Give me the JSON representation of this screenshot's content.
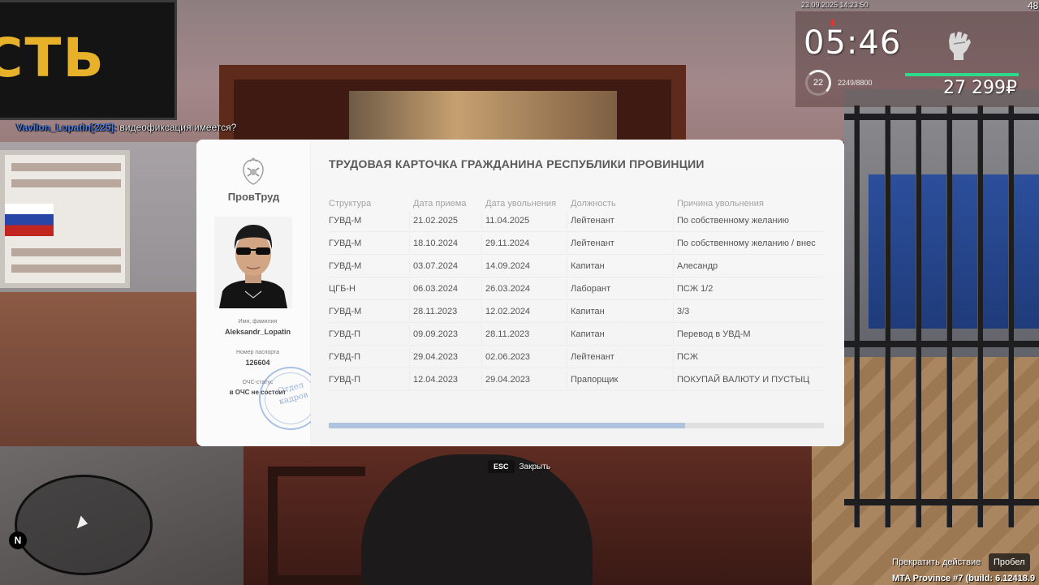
{
  "chat": {
    "name": "Vavilon_Lopatin[225]:",
    "message": " видеофиксация имеется?"
  },
  "scene": {
    "sign_text": "СТЬ"
  },
  "hud": {
    "datetime": "23.09.2025 14:23:50",
    "corner_number": "48",
    "clock": "05:46",
    "level": "22",
    "experience": "2249/8800",
    "money": "27 299₽",
    "health_color": "#2fd98a"
  },
  "card": {
    "brand": "ПровТруд",
    "title": "ТРУДОВАЯ КАРТОЧКА ГРАЖДАНИНА РЕСПУБЛИКИ ПРОВИНЦИИ",
    "name_label": "Имя, фамилия",
    "name_value": "Aleksandr_Lopatin",
    "passport_label": "Номер паспорта",
    "passport_value": "126604",
    "status_label": "ОЧС-статус",
    "status_value": "в ОЧС не состоит",
    "stamp_text": "Отдел кадров",
    "columns": [
      "Структура",
      "Дата приема",
      "Дата увольнения",
      "Должность",
      "Причина увольнения"
    ],
    "rows": [
      [
        "ГУВД-М",
        "21.02.2025",
        "11.04.2025",
        "Лейтенант",
        "По собственному желанию"
      ],
      [
        "ГУВД-М",
        "18.10.2024",
        "29.11.2024",
        "Лейтенант",
        "По собственному желанию / внес"
      ],
      [
        "ГУВД-М",
        "03.07.2024",
        "14.09.2024",
        "Капитан",
        "Алесандр"
      ],
      [
        "ЦГБ-Н",
        "06.03.2024",
        "26.03.2024",
        "Лаборант",
        "ПСЖ 1/2"
      ],
      [
        "ГУВД-М",
        "28.11.2023",
        "12.02.2024",
        "Капитан",
        "3/3"
      ],
      [
        "ГУВД-П",
        "09.09.2023",
        "28.11.2023",
        "Капитан",
        "Перевод в УВД-М"
      ],
      [
        "ГУВД-П",
        "29.04.2023",
        "02.06.2023",
        "Лейтенант",
        "ПСЖ"
      ],
      [
        "ГУВД-П",
        "12.04.2023",
        "29.04.2023",
        "Прапорщик",
        "ПОКУПАЙ ВАЛЮТУ И ПУСТЫЦ"
      ]
    ],
    "scroll_fraction": 0.72,
    "close_key": "ESC",
    "close_label": "Закрыть"
  },
  "bottom": {
    "north_label": "N",
    "stop_action": "Прекратить действие",
    "space_key": "Пробел",
    "build": "MTA Province #7 (build: 6.12418.9"
  }
}
